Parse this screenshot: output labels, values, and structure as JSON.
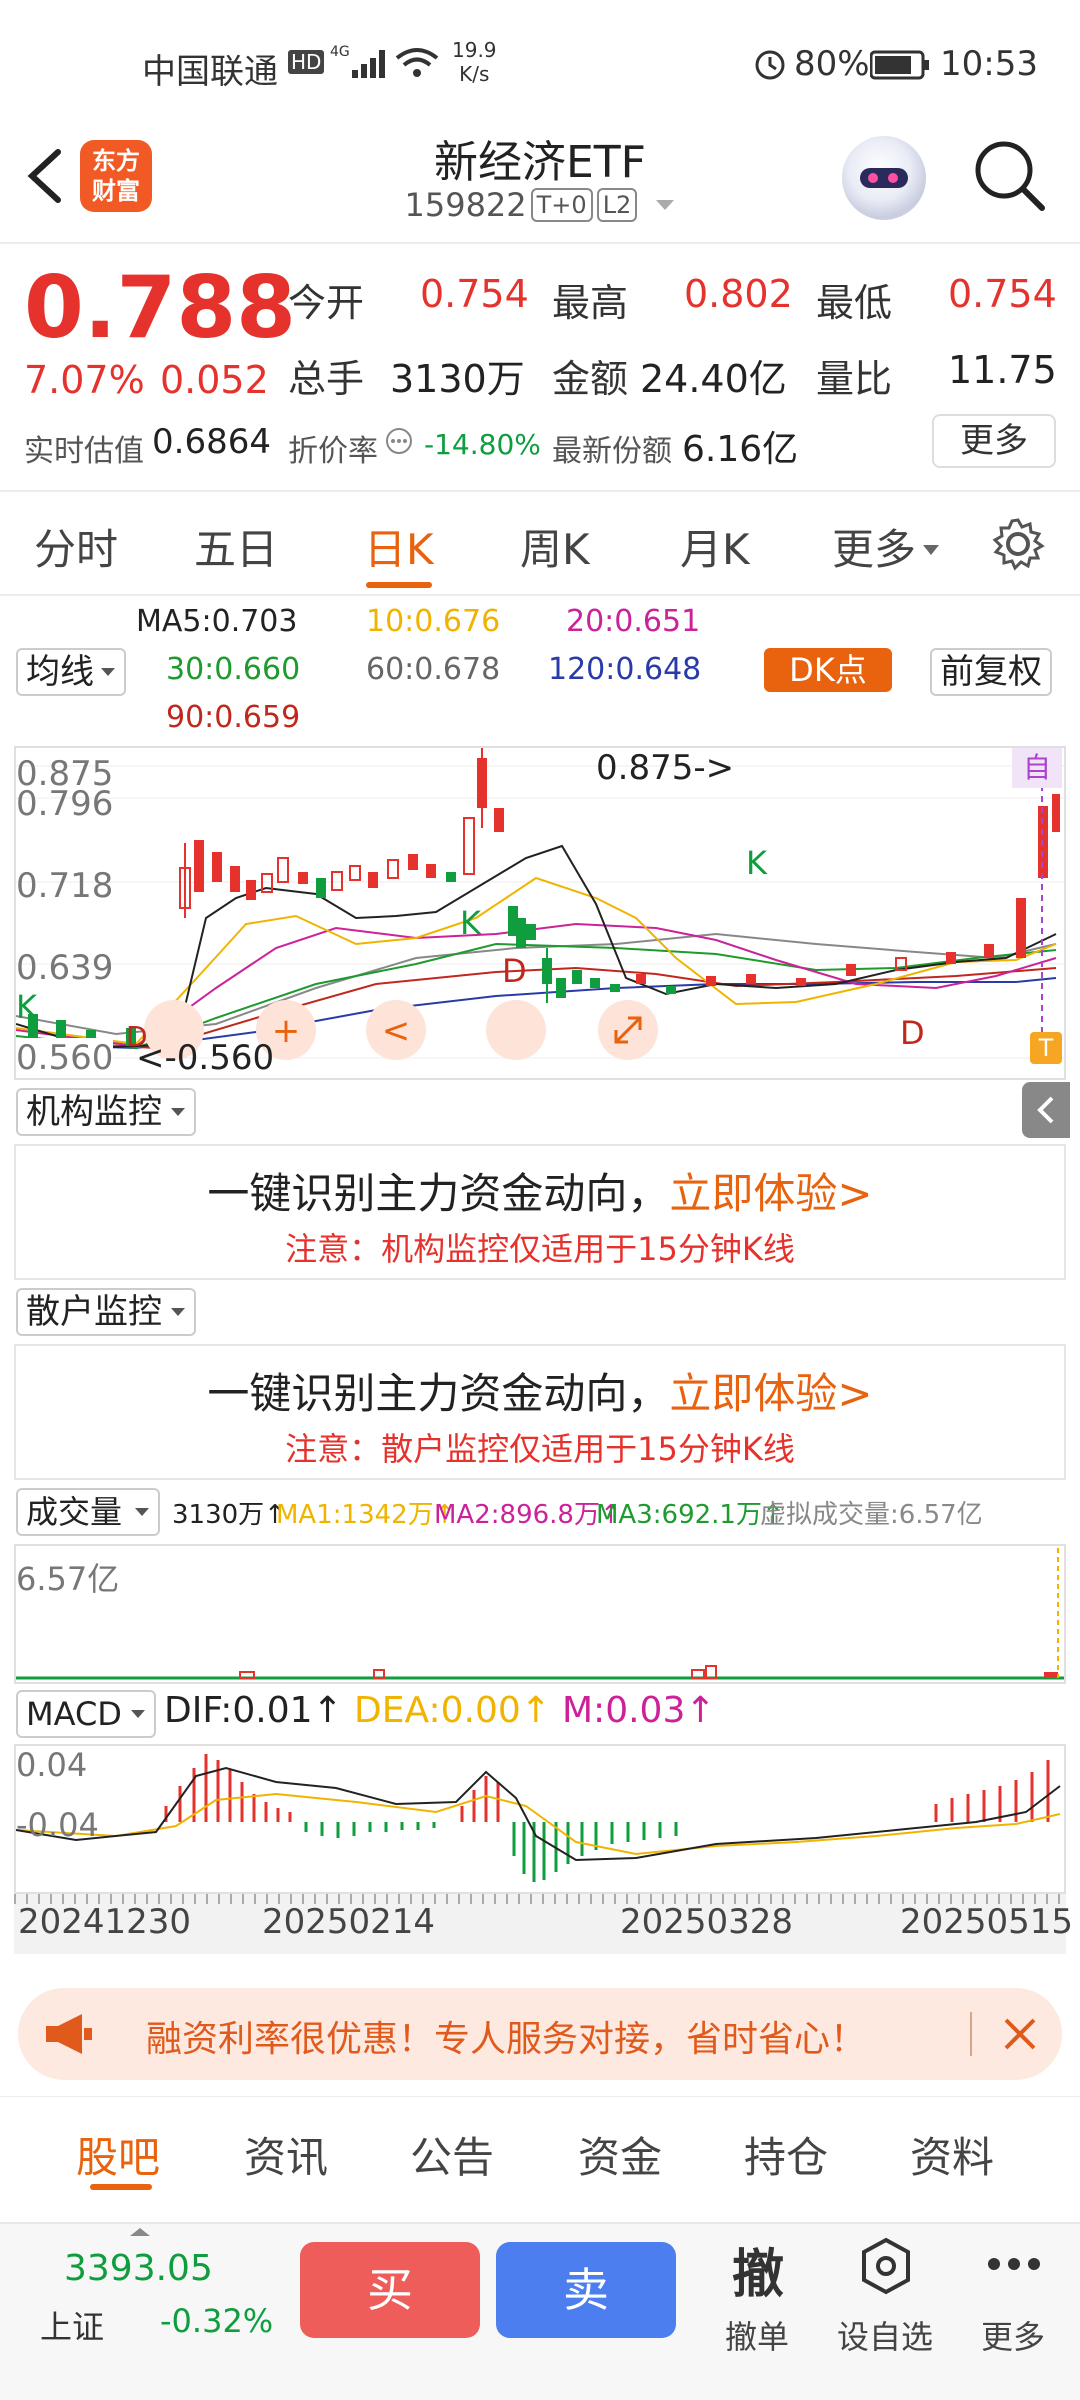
{
  "status_bar": {
    "carrier": "中国联通",
    "hd": "HD",
    "net_speed_value": "19.9",
    "net_speed_unit": "K/s",
    "battery": "80%",
    "time": "10:53"
  },
  "header": {
    "logo_line1": "东方",
    "logo_line2": "财富",
    "title": "新经济ETF",
    "code": "159822",
    "tag1": "T+0",
    "tag2": "L2"
  },
  "quote": {
    "price": "0.788",
    "change_pct": "7.07%",
    "change": "0.052",
    "open_label": "今开",
    "open": "0.754",
    "high_label": "最高",
    "high": "0.802",
    "low_label": "最低",
    "low": "0.754",
    "volume_label": "总手",
    "volume": "3130万",
    "amount_label": "金额",
    "amount": "24.40亿",
    "ratio_label": "量比",
    "ratio": "11.75",
    "est_label": "实时估值",
    "est": "0.6864",
    "discount_label": "折价率",
    "discount": "-14.80%",
    "shares_label": "最新份额",
    "shares": "6.16亿",
    "more": "更多"
  },
  "tabs": [
    "分时",
    "五日",
    "日K",
    "周K",
    "月K",
    "更多"
  ],
  "ma_legend": {
    "selector": "均线",
    "ma5": "MA5:0.703",
    "ma10": "10:0.676",
    "ma20": "20:0.651",
    "ma30": "30:0.660",
    "ma60": "60:0.678",
    "ma120": "120:0.648",
    "ma90": "90:0.659",
    "dk": "DK点",
    "fq": "前复权",
    "colors": {
      "ma5": "#222222",
      "ma10": "#f0b400",
      "ma20": "#cc2299",
      "ma30": "#1e9a2e",
      "ma60": "#888888",
      "ma120": "#2a3aa8",
      "ma90": "#c0281e"
    }
  },
  "kline": {
    "y_labels": [
      "0.875",
      "0.796",
      "0.718",
      "0.639",
      "0.560"
    ],
    "max_note": "0.875->",
    "min_note": "<-0.560",
    "auto_badge": "自",
    "t_badge": "T",
    "k_marks": [
      "K",
      "K",
      "K",
      "K"
    ],
    "d_marks": [
      "D",
      "D",
      "D"
    ],
    "bubble_plus": "+",
    "bubble_left": "<"
  },
  "institution": {
    "selector": "机构监控",
    "main": "一键识别主力资金动向，",
    "cta": "立即体验>",
    "note": "注意：机构监控仅适用于15分钟K线"
  },
  "retail": {
    "selector": "散户监控",
    "main": "一键识别主力资金动向，",
    "cta": "立即体验>",
    "note": "注意：散户监控仅适用于15分钟K线"
  },
  "volume": {
    "selector": "成交量",
    "value": "3130万↑",
    "ma1": "MA1:1342万↑",
    "ma2": "MA2:896.8万↑",
    "ma3": "MA3:692.1万↑",
    "virtual": "虚拟成交量:6.57亿",
    "y_top": "6.57亿"
  },
  "macd": {
    "selector": "MACD",
    "dif": "DIF:0.01↑",
    "dea": "DEA:0.00↑",
    "m": "M:0.03↑",
    "y_top": "0.04",
    "y_bottom": "-0.04"
  },
  "dates": [
    "20241230",
    "20250214",
    "20250328",
    "20250515"
  ],
  "ad": {
    "text": "融资利率很优惠！专人服务对接，省时省心！"
  },
  "bottom_tabs": [
    "股吧",
    "资讯",
    "公告",
    "资金",
    "持仓",
    "资料"
  ],
  "bottom_bar": {
    "index_value": "3393.05",
    "index_name": "上证",
    "index_change": "-0.32%",
    "buy": "买",
    "sell": "卖",
    "cancel_icon": "撤",
    "cancel_label": "撤单",
    "watch_label": "设自选",
    "more_label": "更多"
  }
}
